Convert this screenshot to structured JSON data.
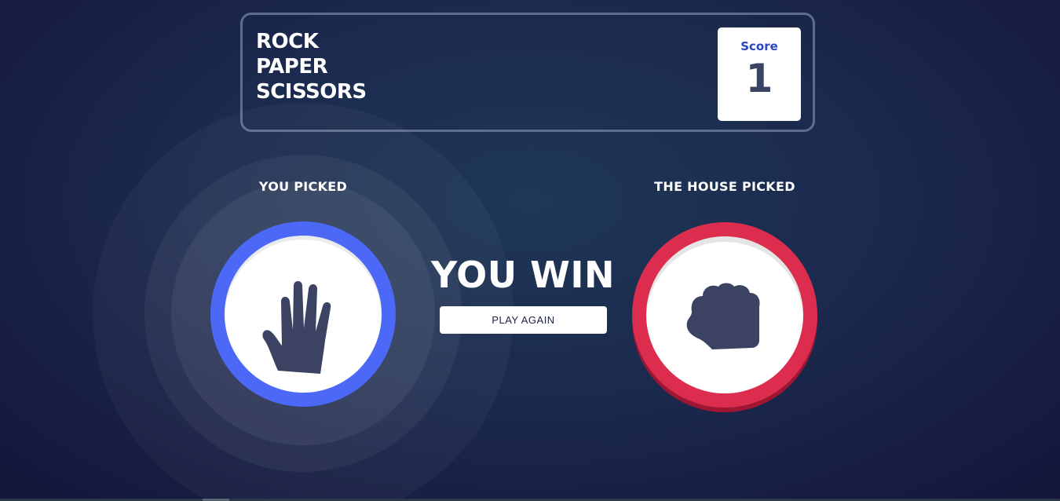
{
  "header": {
    "title_lines": [
      "ROCK",
      "PAPER",
      "SCISSORS"
    ],
    "score_label": "Score",
    "score_value": "1"
  },
  "player": {
    "label": "YOU PICKED",
    "choice_icon": "paper-hand-icon",
    "ring_color": "#4c68f6"
  },
  "house": {
    "label": "THE HOUSE PICKED",
    "choice_icon": "rock-fist-icon",
    "ring_color": "#dc2d4f"
  },
  "result": {
    "text": "YOU WIN",
    "button_label": "PLAY AGAIN"
  }
}
